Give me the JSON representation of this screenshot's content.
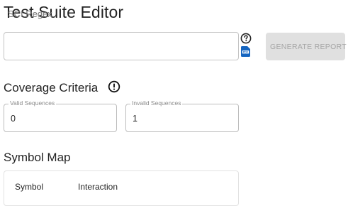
{
  "header": {
    "title": "Test Suite Editor"
  },
  "regex_input": {
    "placeholder": "SCI Regex",
    "value": ""
  },
  "icons": {
    "help": "help-circle-icon",
    "pdf": "pdf-file-icon",
    "info": "alert-circle-icon"
  },
  "generate_button": {
    "label": "GENERATE REPORT",
    "disabled": true
  },
  "coverage": {
    "title": "Coverage Criteria",
    "valid": {
      "label": "Valid Sequences",
      "value": "0"
    },
    "invalid": {
      "label": "Invalid Sequences",
      "value": "1"
    }
  },
  "symbol_map": {
    "title": "Symbol Map",
    "columns": [
      "Symbol",
      "Interaction"
    ]
  },
  "colors": {
    "pdf_icon": "#1565c0",
    "disabled_button_bg": "#e0e0e0",
    "disabled_button_text": "#a6a6a6"
  }
}
